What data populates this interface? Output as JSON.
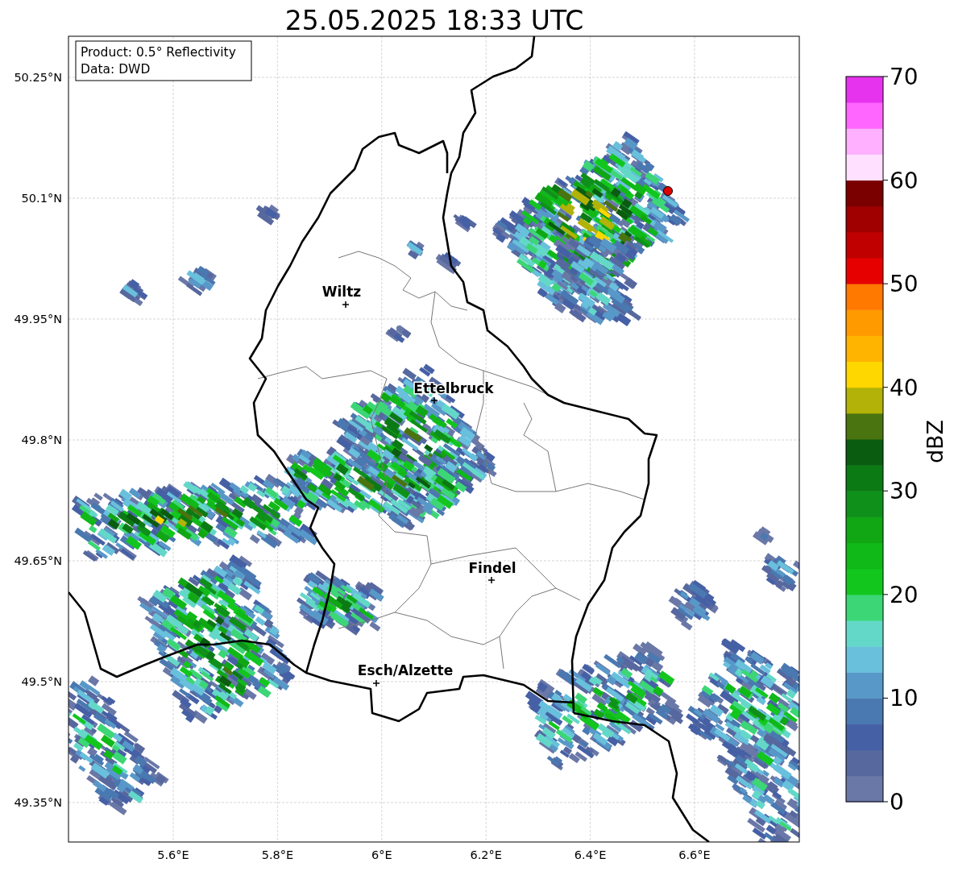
{
  "title": "25.05.2025 18:33 UTC",
  "map": {
    "info_lines": [
      "Product: 0.5° Reflectivity",
      "Data: DWD"
    ],
    "cities": [
      {
        "name": "Wiltz"
      },
      {
        "name": "Ettelbruck"
      },
      {
        "name": "Findel"
      },
      {
        "name": "Esch/Alzette"
      }
    ],
    "lat_ticks": [
      "50.25°N",
      "50.1°N",
      "49.95°N",
      "49.8°N",
      "49.65°N",
      "49.5°N",
      "49.35°N"
    ],
    "lon_ticks": [
      "5.6°E",
      "5.8°E",
      "6°E",
      "6.2°E",
      "6.4°E",
      "6.6°E"
    ]
  },
  "colorbar": {
    "label": "dBZ",
    "ticks": [
      "70",
      "60",
      "50",
      "40",
      "30",
      "20",
      "10",
      "0"
    ],
    "bins": [
      {
        "color": "#6a78a8"
      },
      {
        "color": "#57689f"
      },
      {
        "color": "#4660a5"
      },
      {
        "color": "#4a78b0"
      },
      {
        "color": "#5898c8"
      },
      {
        "color": "#68c0dc"
      },
      {
        "color": "#64d8c8"
      },
      {
        "color": "#3cd676"
      },
      {
        "color": "#12c61e"
      },
      {
        "color": "#10b818"
      },
      {
        "color": "#10a614"
      },
      {
        "color": "#0f901a"
      },
      {
        "color": "#0c7a14"
      },
      {
        "color": "#0a5c10"
      },
      {
        "color": "#4a7410"
      },
      {
        "color": "#b2b208"
      },
      {
        "color": "#ffd700"
      },
      {
        "color": "#ffb400"
      },
      {
        "color": "#ff9a00"
      },
      {
        "color": "#ff7800"
      },
      {
        "color": "#e60000"
      },
      {
        "color": "#c00000"
      },
      {
        "color": "#a00000"
      },
      {
        "color": "#7a0000"
      },
      {
        "color": "#ffe0ff"
      },
      {
        "color": "#ffb0ff"
      },
      {
        "color": "#ff66ff"
      },
      {
        "color": "#e633ee"
      }
    ]
  }
}
